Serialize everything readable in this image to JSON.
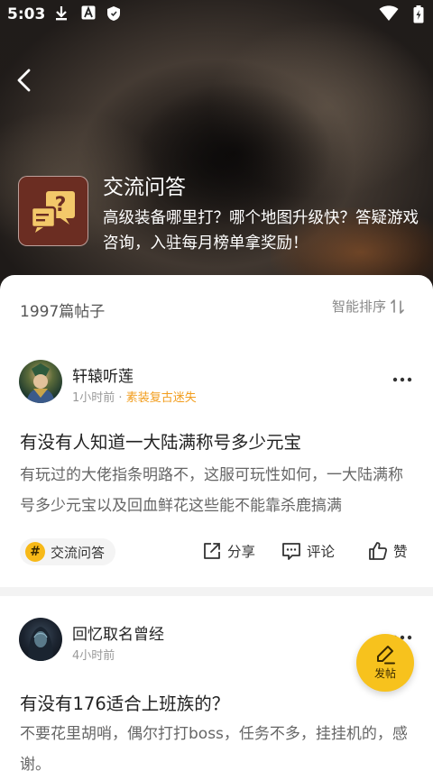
{
  "status_bar": {
    "time": "5:03"
  },
  "header": {
    "title": "交流问答",
    "description": "高级装备哪里打？哪个地图升级快？答疑游戏咨询，入驻每月榜单拿奖励！"
  },
  "list": {
    "post_count": "1997篇帖子",
    "sort_label": "智能排序"
  },
  "posts": [
    {
      "author": "轩辕听莲",
      "time": "1小时前",
      "separator": "·",
      "tag": "素装复古迷失",
      "title": "有没有人知道一大陆满称号多少元宝",
      "body": "有玩过的大佬指条明路不，这服可玩性如何，一大陆满称号多少元宝以及回血鲜花这些能不能靠杀鹿搞满",
      "topic": "交流问答",
      "share": "分享",
      "comment": "评论",
      "like": "赞"
    },
    {
      "author": "回忆取名曾经",
      "time": "4小时前",
      "title": "有没有176适合上班族的？",
      "body": "不要花里胡哨，偶尔打打boss，任务不多，挂挂机的，感谢。"
    }
  ],
  "fab": {
    "label": "发帖"
  },
  "colors": {
    "accent": "#f7c21d",
    "tag": "#f29d1d",
    "topic_icon_bg": "#6b2d22"
  }
}
